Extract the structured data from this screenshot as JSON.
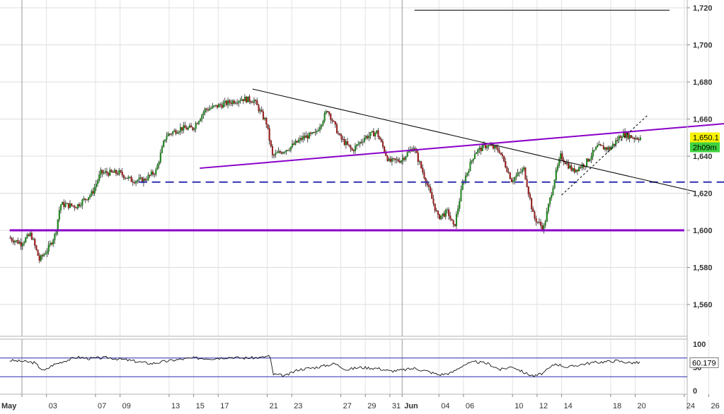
{
  "chart_data": {
    "type": "candlestick",
    "price_panel": {
      "ylim": [
        1544,
        1722
      ],
      "yticks": [
        1560,
        1580,
        1600,
        1620,
        1640,
        1660,
        1680,
        1700,
        1720
      ],
      "ytick_labels": [
        "1,560",
        "1,580",
        "1,600",
        "1,620",
        "1,640",
        "1,660",
        "1,680",
        "1,700",
        "1,720"
      ],
      "last_price_label": "1,650.1",
      "last_price": 1650.1,
      "countdown_label": "2h09m",
      "grid": true
    },
    "x_axis": {
      "ticks": [
        {
          "label": "May",
          "day": 1,
          "bold": true
        },
        {
          "label": "03",
          "day": 3
        },
        {
          "label": "07",
          "day": 7
        },
        {
          "label": "09",
          "day": 9
        },
        {
          "label": "13",
          "day": 13
        },
        {
          "label": "15",
          "day": 15
        },
        {
          "label": "17",
          "day": 17
        },
        {
          "label": "21",
          "day": 21
        },
        {
          "label": "23",
          "day": 23
        },
        {
          "label": "27",
          "day": 27
        },
        {
          "label": "29",
          "day": 29
        },
        {
          "label": "31",
          "day": 31
        },
        {
          "label": "Jun",
          "day": 32,
          "bold": true
        },
        {
          "label": "04",
          "day": 35
        },
        {
          "label": "06",
          "day": 37
        },
        {
          "label": "10",
          "day": 41
        },
        {
          "label": "12",
          "day": 43
        },
        {
          "label": "14",
          "day": 45
        },
        {
          "label": "18",
          "day": 49
        },
        {
          "label": "20",
          "day": 51
        },
        {
          "label": "24",
          "day": 55
        },
        {
          "label": "26",
          "day": 57
        }
      ]
    },
    "price_path": [
      [
        0.0,
        1596
      ],
      [
        1.0,
        1593
      ],
      [
        1.8,
        1598
      ],
      [
        2.5,
        1584
      ],
      [
        3.2,
        1590
      ],
      [
        3.8,
        1598
      ],
      [
        4.2,
        1614
      ],
      [
        5.5,
        1613
      ],
      [
        6.8,
        1620
      ],
      [
        7.5,
        1631
      ],
      [
        9.0,
        1631
      ],
      [
        10.0,
        1627
      ],
      [
        11.0,
        1627
      ],
      [
        12.0,
        1632
      ],
      [
        12.8,
        1651
      ],
      [
        14.0,
        1655
      ],
      [
        15.0,
        1655
      ],
      [
        16.0,
        1665
      ],
      [
        17.5,
        1668
      ],
      [
        19.0,
        1671
      ],
      [
        20.0,
        1670
      ],
      [
        21.0,
        1658
      ],
      [
        21.5,
        1640
      ],
      [
        23.0,
        1645
      ],
      [
        24.0,
        1650
      ],
      [
        25.0,
        1652
      ],
      [
        26.0,
        1665
      ],
      [
        27.0,
        1650
      ],
      [
        28.0,
        1643
      ],
      [
        29.0,
        1650
      ],
      [
        30.0,
        1653
      ],
      [
        31.0,
        1637
      ],
      [
        32.0,
        1638
      ],
      [
        33.0,
        1645
      ],
      [
        34.0,
        1627
      ],
      [
        35.0,
        1607
      ],
      [
        35.8,
        1610
      ],
      [
        36.3,
        1601
      ],
      [
        37.0,
        1625
      ],
      [
        38.0,
        1642
      ],
      [
        39.0,
        1646
      ],
      [
        40.0,
        1643
      ],
      [
        41.0,
        1627
      ],
      [
        42.0,
        1633
      ],
      [
        42.8,
        1607
      ],
      [
        43.6,
        1601
      ],
      [
        44.5,
        1628
      ],
      [
        45.0,
        1640
      ],
      [
        46.0,
        1632
      ],
      [
        47.0,
        1636
      ],
      [
        48.0,
        1645
      ],
      [
        49.0,
        1644
      ],
      [
        50.0,
        1652
      ],
      [
        51.0,
        1650
      ],
      [
        51.4,
        1650
      ]
    ],
    "horizontal_levels": [
      {
        "value": 1718.7,
        "from_day": 33.0,
        "to_day": 53.8,
        "color": "#000000",
        "style": "solid",
        "width": 1
      },
      {
        "value": 1626,
        "from_day": 10.5,
        "to_day": 61.0,
        "color": "#3030b0",
        "style": "dashed",
        "width": 2
      },
      {
        "value": 1600,
        "from_day": 0.0,
        "to_day": 55.0,
        "color": "#8a00c8",
        "style": "solid",
        "width": 3
      }
    ],
    "trendlines": [
      {
        "start": [
          19.8,
          1676.2
        ],
        "end": [
          55.8,
          1621.0
        ],
        "color": "#000000",
        "style": "solid",
        "width": 1
      },
      {
        "start": [
          15.5,
          1633.5
        ],
        "end": [
          59.5,
          1658.2
        ],
        "color": "#8a00c8",
        "style": "solid",
        "width": 2
      },
      {
        "start": [
          45.0,
          1619.0
        ],
        "end": [
          52.0,
          1662.0
        ],
        "color": "#000000",
        "style": "dotted",
        "width": 1
      }
    ],
    "rsi_panel": {
      "ylim": [
        0,
        100
      ],
      "ytick_labels": [
        "100",
        "50",
        "0"
      ],
      "yticks": [
        100,
        50,
        0
      ],
      "overbought": 70,
      "oversold": 30,
      "last_value_label": "60.179",
      "last_value": 60.179,
      "path": [
        [
          0.0,
          65
        ],
        [
          1.0,
          63
        ],
        [
          2.0,
          60
        ],
        [
          2.8,
          42
        ],
        [
          3.5,
          55
        ],
        [
          4.5,
          64
        ],
        [
          5.5,
          72
        ],
        [
          6.5,
          69
        ],
        [
          8.0,
          71
        ],
        [
          9.5,
          66
        ],
        [
          10.5,
          62
        ],
        [
          11.5,
          58
        ],
        [
          12.5,
          62
        ],
        [
          13.5,
          66
        ],
        [
          15.0,
          70
        ],
        [
          16.5,
          69
        ],
        [
          18.0,
          72
        ],
        [
          19.0,
          70
        ],
        [
          20.5,
          71
        ],
        [
          21.2,
          75
        ],
        [
          21.5,
          35
        ],
        [
          22.5,
          32
        ],
        [
          23.5,
          45
        ],
        [
          25.0,
          50
        ],
        [
          26.5,
          58
        ],
        [
          27.5,
          45
        ],
        [
          28.5,
          50
        ],
        [
          30.0,
          48
        ],
        [
          31.0,
          42
        ],
        [
          32.0,
          44
        ],
        [
          33.0,
          48
        ],
        [
          34.0,
          42
        ],
        [
          35.0,
          34
        ],
        [
          36.0,
          38
        ],
        [
          37.0,
          55
        ],
        [
          38.0,
          62
        ],
        [
          39.0,
          58
        ],
        [
          40.0,
          45
        ],
        [
          41.0,
          52
        ],
        [
          42.0,
          38
        ],
        [
          42.8,
          31
        ],
        [
          43.5,
          38
        ],
        [
          44.5,
          58
        ],
        [
          45.5,
          50
        ],
        [
          46.5,
          56
        ],
        [
          47.5,
          60
        ],
        [
          48.5,
          62
        ],
        [
          49.5,
          64
        ],
        [
          50.5,
          60
        ],
        [
          51.4,
          60
        ]
      ]
    }
  }
}
